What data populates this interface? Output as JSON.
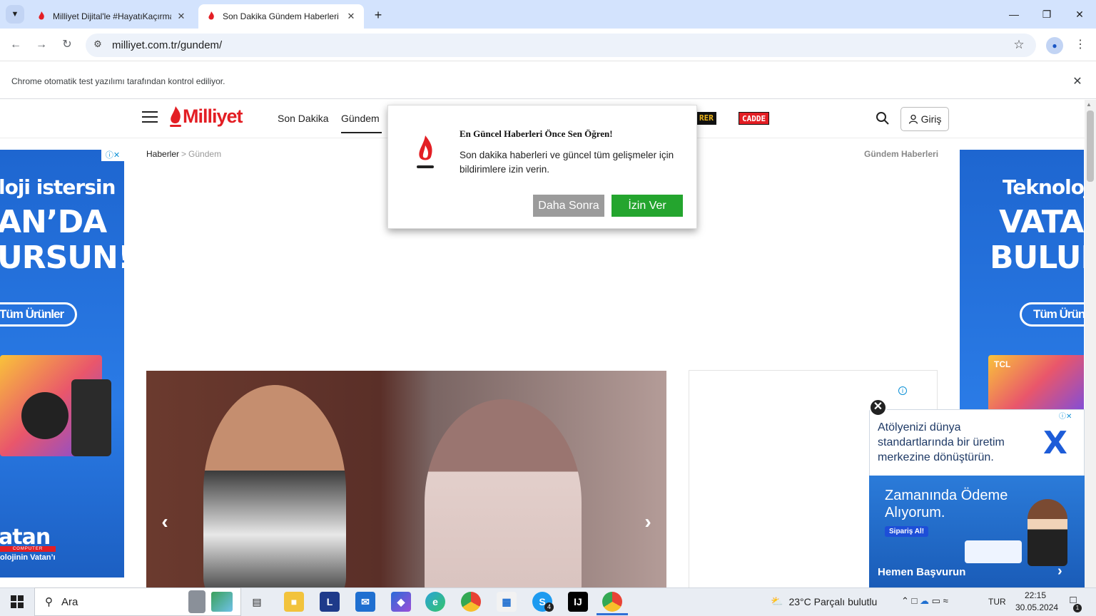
{
  "browser": {
    "tabs": [
      {
        "title": "Milliyet Dijital'le #HayatıKaçırma",
        "active": false
      },
      {
        "title": "Son Dakika Gündem Haberleri -",
        "active": true
      }
    ],
    "url": "milliyet.com.tr/gundem/",
    "infobar_text": "Chrome otomatik test yazılımı tarafından kontrol ediliyor.",
    "new_tab_label": "+"
  },
  "site": {
    "logo": "Milliyet",
    "nav": [
      "Son Dakika",
      "Gündem"
    ],
    "brand_badges": [
      "RER",
      "CADDE"
    ],
    "login_label": "Giriş",
    "breadcrumb": {
      "home": "Haberler",
      "separator": ">",
      "current": "Gündem"
    },
    "section_title": "Gündem Haberleri"
  },
  "popup": {
    "title": "En Güncel Haberleri Önce Sen Öğren!",
    "body": "Son dakika haberleri ve güncel tüm gelişmeler için bildirimlere izin verin.",
    "later_label": "Daha Sonra",
    "allow_label": "İzin Ver"
  },
  "ads": {
    "left": {
      "line1": "loji istersin",
      "line2": "AN’DA",
      "line3": "URSUN!",
      "button": "Tüm Ürünler",
      "brand": "atan",
      "brand_sub": "COMPUTER",
      "tagline": "olojinin Vatan’ı"
    },
    "right": {
      "line1": "Teknoloji is",
      "line2": "VATAN",
      "line3": "BULURS",
      "button": "Tüm Ürün",
      "tv_brand": "TCL"
    },
    "float": {
      "top_text": "Atölyenizi dünya standartlarında bir üretim merkezine dönüştürün.",
      "headline": "Zamanında Ödeme Alıyorum.",
      "cta": "Sipariş Al!",
      "apply": "Hemen Başvurun"
    }
  },
  "taskbar": {
    "search_label": "Ara",
    "weather": "23°C  Parçalı bulutlu",
    "language": "TUR",
    "time": "22:15",
    "date": "30.05.2024",
    "skype_badge": "4",
    "notification_count": "1"
  },
  "colors": {
    "brand_red": "#e31e24",
    "allow_green": "#24a52e",
    "later_gray": "#9b9b9b",
    "ad_blue": "#2a7be6"
  }
}
